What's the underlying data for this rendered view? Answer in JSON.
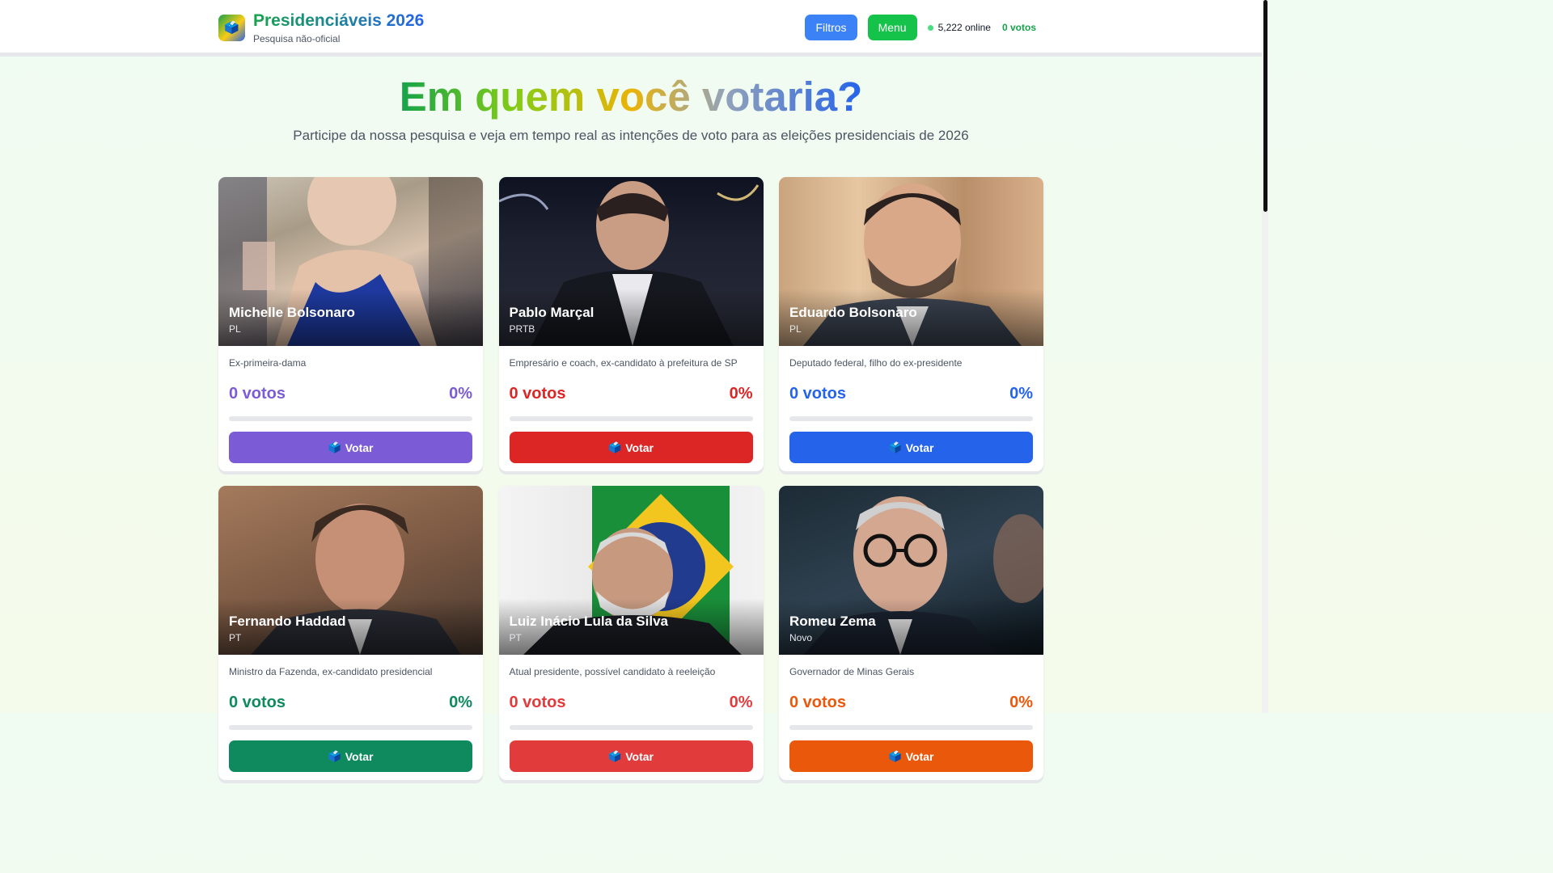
{
  "header": {
    "logo_icon": "🗳️",
    "title": "Presidenciáveis 2026",
    "subtitle": "Pesquisa não-oficial",
    "filter_label": "Filtros",
    "menu_label": "Menu",
    "online_text": "5,222 online",
    "votes_text": "0 votos"
  },
  "hero": {
    "title": "Em quem você votaria?",
    "subtitle": "Participe da nossa pesquisa e veja em tempo real as intenções de voto para as eleições presidenciais de 2026"
  },
  "candidates": [
    {
      "name": "Michelle Bolsonaro",
      "party": "PL",
      "description": "Ex-primeira-dama",
      "votes": "0 votos",
      "percent": "0%",
      "vote_fraction": 0,
      "button": "Votar",
      "button_icon": "🗳️",
      "color": "#7c5cd6"
    },
    {
      "name": "Pablo Marçal",
      "party": "PRTB",
      "description": "Empresário e coach, ex-candidato à prefeitura de SP",
      "votes": "0 votos",
      "percent": "0%",
      "vote_fraction": 0,
      "button": "Votar",
      "button_icon": "🗳️",
      "color": "#dc2626"
    },
    {
      "name": "Eduardo Bolsonaro",
      "party": "PL",
      "description": "Deputado federal, filho do ex-presidente",
      "votes": "0 votos",
      "percent": "0%",
      "vote_fraction": 0,
      "button": "Votar",
      "button_icon": "🗳️",
      "color": "#2563eb"
    },
    {
      "name": "Fernando Haddad",
      "party": "PT",
      "description": "Ministro da Fazenda, ex-candidato presidencial",
      "votes": "0 votos",
      "percent": "0%",
      "vote_fraction": 0,
      "button": "Votar",
      "button_icon": "🗳️",
      "color": "#0f8a5f"
    },
    {
      "name": "Luiz Inácio Lula da Silva",
      "party": "PT",
      "description": "Atual presidente, possível candidato à reeleição",
      "votes": "0 votos",
      "percent": "0%",
      "vote_fraction": 0,
      "button": "Votar",
      "button_icon": "🗳️",
      "color": "#e23b3b"
    },
    {
      "name": "Romeu Zema",
      "party": "Novo",
      "description": "Governador de Minas Gerais",
      "votes": "0 votos",
      "percent": "0%",
      "vote_fraction": 0,
      "button": "Votar",
      "button_icon": "🗳️",
      "color": "#ea580c"
    }
  ]
}
